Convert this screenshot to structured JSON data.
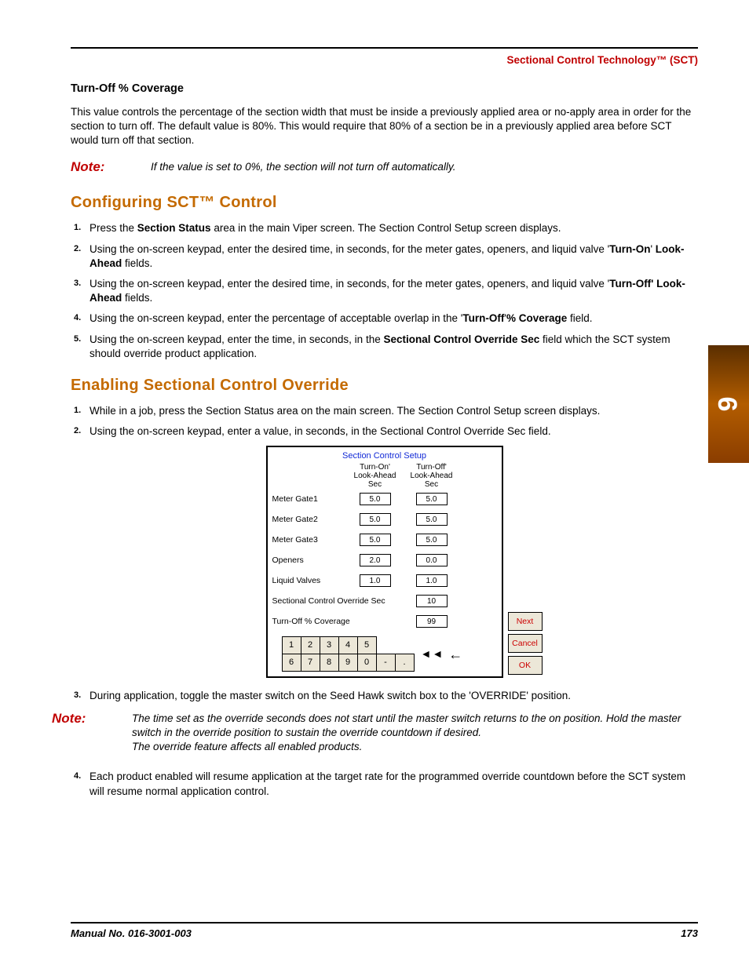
{
  "header": {
    "title": "Sectional Control Technology™ (SCT)"
  },
  "s1": {
    "heading": "Turn-Off % Coverage",
    "para": "This value controls the percentage of the section width that must be inside a previously applied area or no-apply area in order for the section to turn off. The default value is 80%. This would require that 80% of a section be in a previously applied area before SCT would turn off that section.",
    "note_label": "Note:",
    "note_body": "If the value is set to 0%, the section will not turn off automatically."
  },
  "s2": {
    "heading": "Configuring SCT™ Control",
    "steps": {
      "a": {
        "pre": "Press the ",
        "b1": "Section Status",
        "post": " area in the main Viper screen. The Section Control Setup screen displays."
      },
      "b": {
        "pre": "Using the on-screen keypad, enter the desired time, in seconds, for the meter gates, openers, and liquid valve '",
        "b1": "Turn-On",
        "mid": "' ",
        "b2": "Look-Ahead",
        "post": " fields."
      },
      "c": {
        "pre": "Using the on-screen keypad, enter the desired time, in seconds, for the meter gates, openers, and liquid valve '",
        "b1": "Turn-Off' Look-Ahead",
        "post": " fields."
      },
      "d": {
        "pre": "Using the on-screen keypad, enter the percentage of acceptable overlap in the '",
        "b1": "Turn-Off",
        "mid": "'",
        "b2": "% Coverage",
        "post": " field."
      },
      "e": {
        "pre": "Using the on-screen keypad, enter the time, in seconds, in the ",
        "b1": "Sectional Control Override Sec",
        "post": " field which the SCT system should override product application."
      }
    }
  },
  "s3": {
    "heading": "Enabling Sectional Control Override",
    "step1": "While in a job, press the Section Status area on the main screen. The Section Control Setup screen displays.",
    "step2": "Using the on-screen keypad, enter a value, in seconds, in the Sectional Control Override Sec field.",
    "step3": "During application, toggle the master switch on the Seed Hawk switch box to the 'OVERRIDE' position.",
    "step4": "Each product enabled will resume application at the target rate for the programmed override countdown before the SCT system will resume normal application control.",
    "note_label": "Note:",
    "note_body1": "The time set as the override seconds does not start until the master switch returns to the on position. Hold the master switch in the override position to sustain the override countdown if desired.",
    "note_body2": "The override feature affects all enabled products."
  },
  "panel": {
    "title": "Section Control Setup",
    "col1": "Turn-On'\nLook-Ahead\nSec",
    "col2": "Turn-Off'\nLook-Ahead\nSec",
    "rows": [
      {
        "label": "Meter Gate1",
        "on": "5.0",
        "off": "5.0"
      },
      {
        "label": "Meter Gate2",
        "on": "5.0",
        "off": "5.0"
      },
      {
        "label": "Meter Gate3",
        "on": "5.0",
        "off": "5.0"
      },
      {
        "label": "Openers",
        "on": "2.0",
        "off": "0.0"
      },
      {
        "label": "Liquid Valves",
        "on": "1.0",
        "off": "1.0"
      }
    ],
    "override_label": "Sectional Control Override Sec",
    "override_val": "10",
    "coverage_label": "Turn-Off % Coverage",
    "coverage_val": "99",
    "btn_next": "Next",
    "btn_cancel": "Cancel",
    "btn_ok": "OK",
    "keys": {
      "r1": [
        "1",
        "2",
        "3",
        "4",
        "5"
      ],
      "r2": [
        "6",
        "7",
        "8",
        "9",
        "0",
        "-",
        "."
      ]
    }
  },
  "sidetab": {
    "num": "9"
  },
  "footer": {
    "left": "Manual No. 016-3001-003",
    "right": "173"
  }
}
